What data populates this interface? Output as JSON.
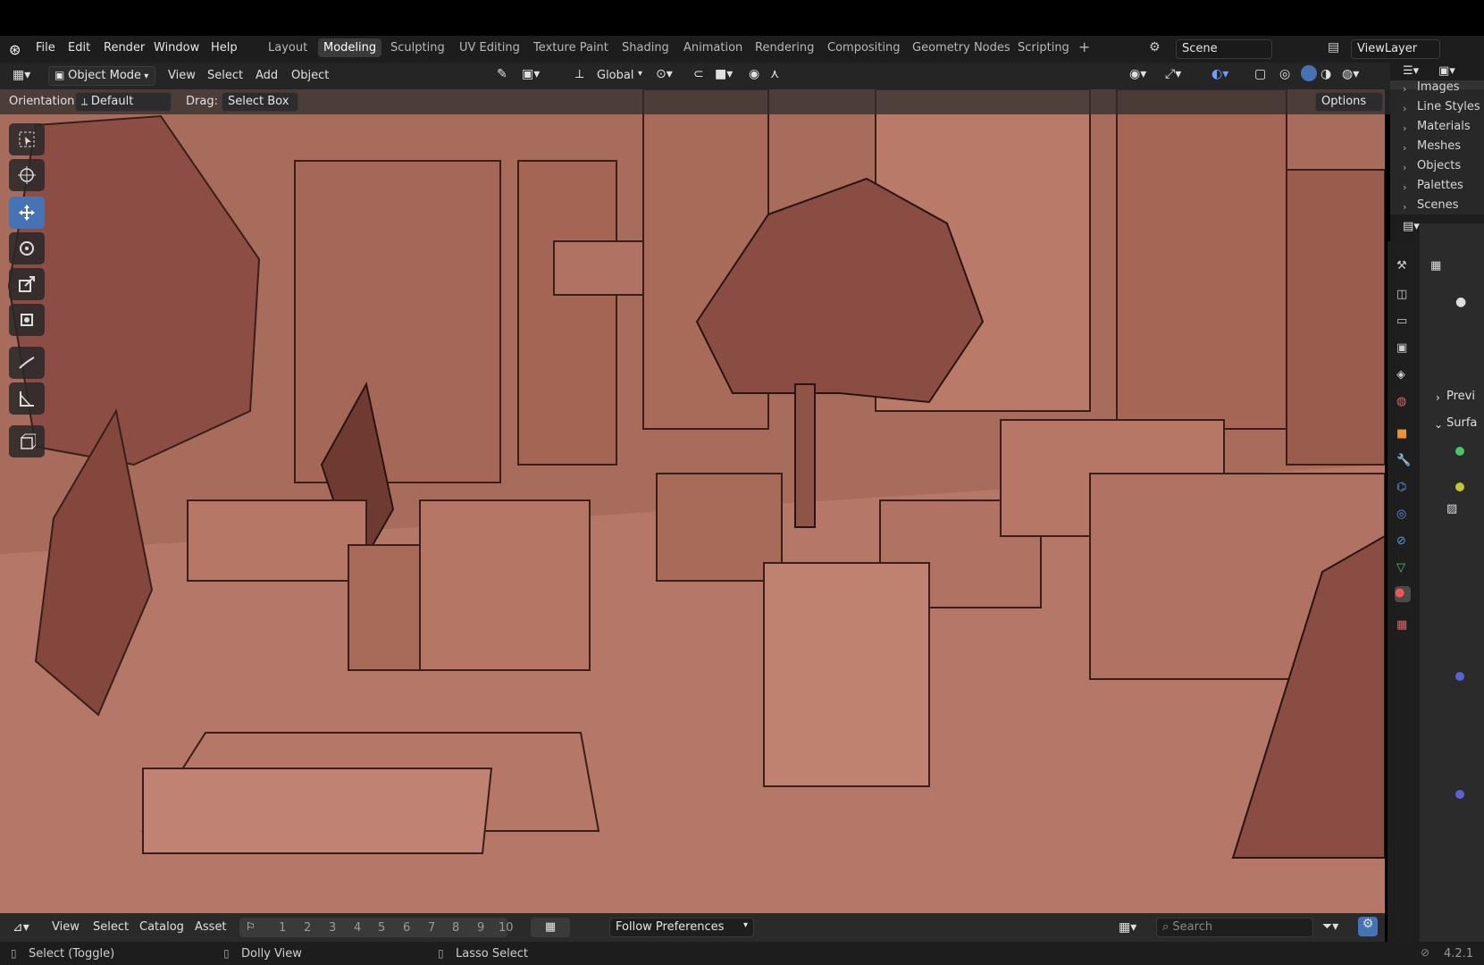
{
  "menu": [
    "File",
    "Edit",
    "Render",
    "Window",
    "Help"
  ],
  "workspaces": [
    "Layout",
    "Modeling",
    "Sculpting",
    "UV Editing",
    "Texture Paint",
    "Shading",
    "Animation",
    "Rendering",
    "Compositing",
    "Geometry Nodes",
    "Scripting"
  ],
  "active_workspace": "Modeling",
  "scene": "Scene",
  "view_layer": "ViewLayer",
  "header": {
    "mode": "Object Mode",
    "view": "View",
    "select": "Select",
    "add": "Add",
    "object": "Object",
    "transform_orientation": "Global",
    "options": "Options"
  },
  "tool_settings": {
    "orientation_label": "Orientation:",
    "orientation_value": "Default",
    "drag_label": "Drag:",
    "drag_value": "Select Box"
  },
  "outliner": [
    "Images",
    "Line Styles",
    "Materials",
    "Meshes",
    "Objects",
    "Palettes",
    "Scenes"
  ],
  "properties": {
    "preview": "Previ",
    "surface": "Surfa"
  },
  "footer": {
    "view": "View",
    "select": "Select",
    "catalog": "Catalog",
    "asset": "Asset",
    "keys": [
      "1",
      "2",
      "3",
      "4",
      "5",
      "6",
      "7",
      "8",
      "9",
      "10"
    ],
    "follow": "Follow Preferences",
    "search_placeholder": "Search"
  },
  "status": {
    "left": "Select (Toggle)",
    "middle": "Dolly View",
    "right": "Lasso Select",
    "version": "4.2.1"
  },
  "colors": {
    "accent": "#4772b3",
    "viewport": "#b67564"
  }
}
